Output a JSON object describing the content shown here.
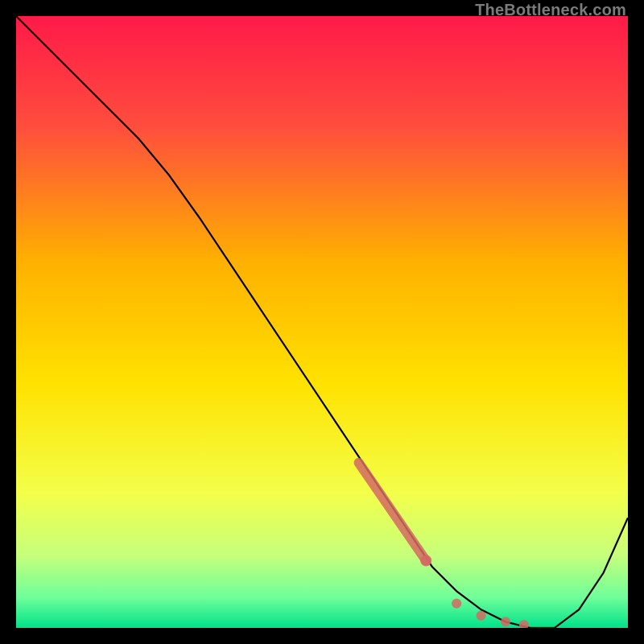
{
  "watermark": "TheBottleneck.com",
  "chart_data": {
    "type": "line",
    "title": "",
    "xlabel": "",
    "ylabel": "",
    "xlim": [
      0,
      100
    ],
    "ylim": [
      0,
      100
    ],
    "grid": false,
    "legend": false,
    "background_gradient": {
      "top": "#ff1a49",
      "upper_mid": "#ffb000",
      "mid": "#ffe200",
      "lower_mid": "#e6ff6f",
      "near_bottom": "#6fff9a",
      "bottom": "#00e28a"
    },
    "series": [
      {
        "name": "curve",
        "color": "#000000",
        "x": [
          0,
          10,
          20,
          25,
          30,
          40,
          50,
          60,
          68,
          72,
          76,
          80,
          84,
          88,
          92,
          96,
          100
        ],
        "y": [
          100,
          90,
          80,
          74,
          67,
          52,
          37,
          22,
          10,
          6,
          3,
          1,
          0,
          0,
          3,
          9,
          18
        ]
      }
    ],
    "highlight_band": {
      "name": "dotted-accent",
      "color": "#d46a63",
      "points": [
        {
          "x": 56,
          "y": 27
        },
        {
          "x": 67,
          "y": 11
        },
        {
          "x": 72,
          "y": 4
        },
        {
          "x": 76,
          "y": 2
        },
        {
          "x": 80,
          "y": 1
        },
        {
          "x": 83,
          "y": 0.5
        }
      ]
    }
  }
}
